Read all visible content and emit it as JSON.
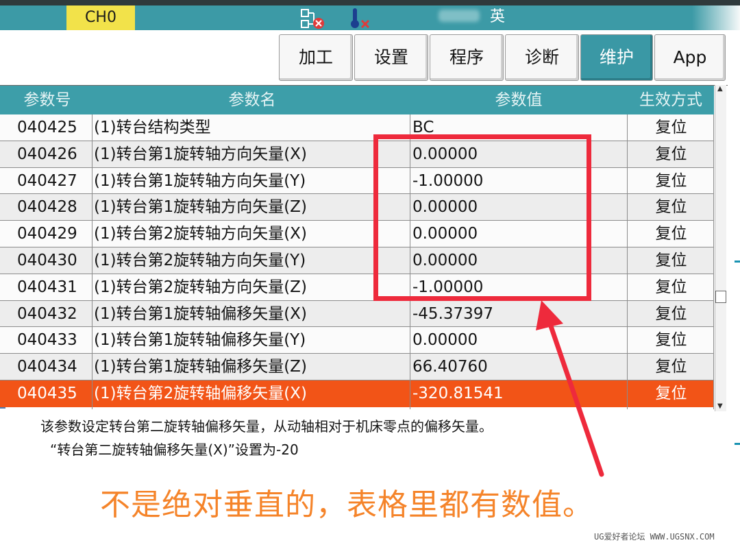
{
  "status_bar": {
    "channel": "CH0",
    "language": "英"
  },
  "tabs": [
    {
      "label": "加工",
      "active": false
    },
    {
      "label": "设置",
      "active": false
    },
    {
      "label": "程序",
      "active": false
    },
    {
      "label": "诊断",
      "active": false
    },
    {
      "label": "维护",
      "active": true
    },
    {
      "label": "App",
      "active": false
    }
  ],
  "table": {
    "headers": [
      "参数号",
      "参数名",
      "参数值",
      "生效方式"
    ],
    "rows": [
      {
        "no": "040425",
        "name": "(1)转台结构类型",
        "value": "BC",
        "mode": "复位"
      },
      {
        "no": "040426",
        "name": "(1)转台第1旋转轴方向矢量(X)",
        "value": "0.00000",
        "mode": "复位"
      },
      {
        "no": "040427",
        "name": "(1)转台第1旋转轴方向矢量(Y)",
        "value": "-1.00000",
        "mode": "复位"
      },
      {
        "no": "040428",
        "name": "(1)转台第1旋转轴方向矢量(Z)",
        "value": "0.00000",
        "mode": "复位"
      },
      {
        "no": "040429",
        "name": "(1)转台第2旋转轴方向矢量(X)",
        "value": "0.00000",
        "mode": "复位"
      },
      {
        "no": "040430",
        "name": "(1)转台第2旋转轴方向矢量(Y)",
        "value": "0.00000",
        "mode": "复位"
      },
      {
        "no": "040431",
        "name": "(1)转台第2旋转轴方向矢量(Z)",
        "value": "-1.00000",
        "mode": "复位"
      },
      {
        "no": "040432",
        "name": "(1)转台第1旋转轴偏移矢量(X)",
        "value": "-45.37397",
        "mode": "复位"
      },
      {
        "no": "040433",
        "name": "(1)转台第1旋转轴偏移矢量(Y)",
        "value": "0.00000",
        "mode": "复位"
      },
      {
        "no": "040434",
        "name": "(1)转台第1旋转轴偏移矢量(Z)",
        "value": "66.40760",
        "mode": "复位"
      },
      {
        "no": "040435",
        "name": "(1)转台第2旋转轴偏移矢量(X)",
        "value": "-320.81541",
        "mode": "复位",
        "selected": true
      }
    ]
  },
  "description": {
    "line1": "该参数设定转台第二旋转轴偏移矢量，从动轴相对于机床零点的偏移矢量。",
    "line2": "“转台第二旋转轴偏移矢量(X)”设置为-20"
  },
  "annotation": {
    "caption": "不是绝对垂直的，表格里都有数值。"
  },
  "watermark": "UG爱好者论坛 WWW.UGSNX.COM",
  "colors": {
    "teal": "#3d9ea9",
    "selected_row": "#f25417",
    "annotation_red": "#ee2a3c",
    "caption_orange": "#f5842a",
    "channel_yellow": "#f2e24a"
  }
}
